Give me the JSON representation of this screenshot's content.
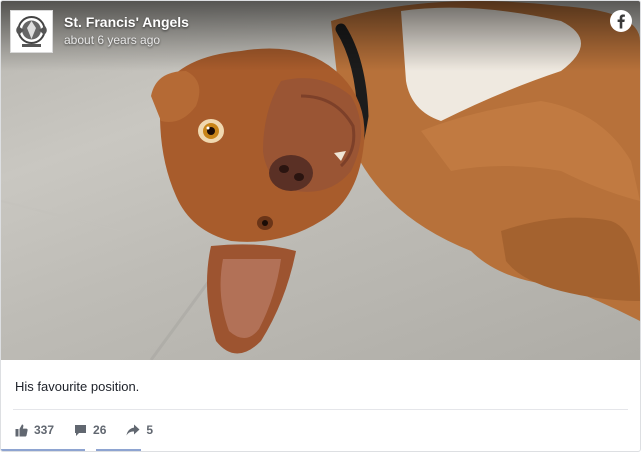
{
  "page": {
    "name": "St. Francis' Angels",
    "timestamp": "about 6 years ago"
  },
  "post": {
    "caption": "His favourite position."
  },
  "stats": {
    "likes": "337",
    "comments": "26",
    "shares": "5"
  },
  "icons": {
    "logo": "page-logo-icon",
    "facebook": "facebook-icon",
    "like": "like-icon",
    "comment": "comment-icon",
    "share": "share-icon"
  },
  "colors": {
    "facebook_blue": "#ffffff",
    "stat_text": "#616770",
    "caption_text": "#1d2129"
  }
}
